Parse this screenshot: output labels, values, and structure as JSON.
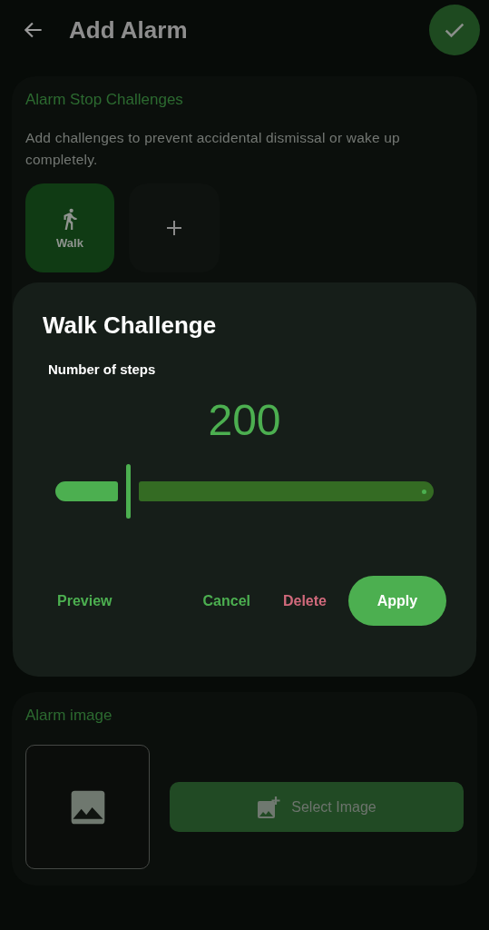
{
  "header": {
    "title": "Add Alarm"
  },
  "challenges_card": {
    "title": "Alarm Stop Challenges",
    "description": "Add challenges to prevent accidental dismissal or wake up completely.",
    "challenges": [
      {
        "kind": "walk",
        "label": "Walk"
      }
    ]
  },
  "dialog": {
    "title": "Walk Challenge",
    "field_label": "Number of steps",
    "value": "200",
    "slider": {
      "level": 0.19
    },
    "actions": [
      {
        "kind": "text",
        "label": "Preview"
      },
      {
        "kind": "text",
        "label": "Cancel"
      },
      {
        "kind": "danger",
        "label": "Delete"
      },
      {
        "kind": "filled",
        "label": "Apply"
      }
    ]
  },
  "image_card": {
    "title": "Alarm image",
    "button": "Select Image"
  }
}
